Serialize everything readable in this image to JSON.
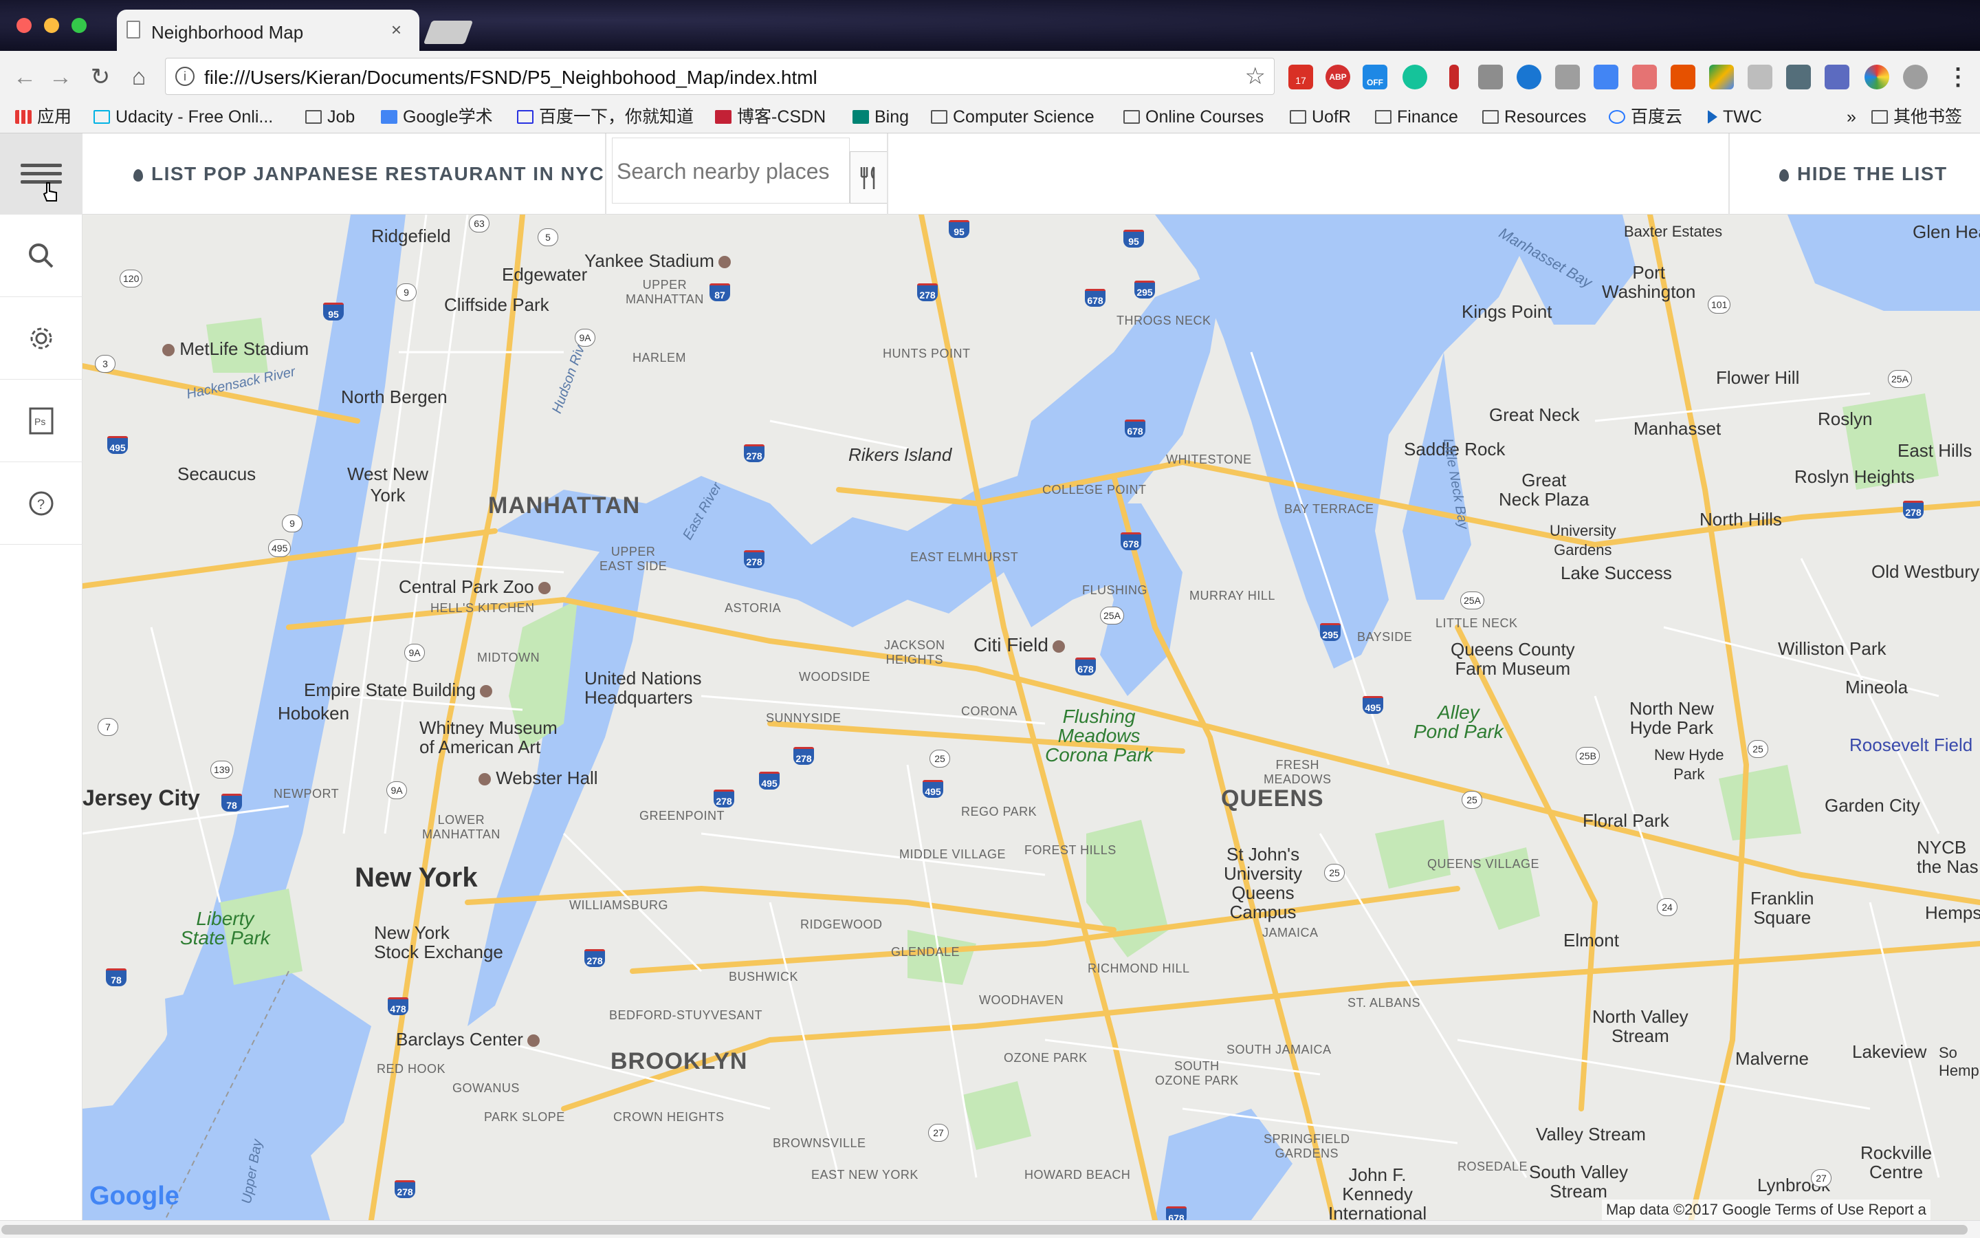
{
  "browser": {
    "tab_title": "Neighborhood Map",
    "tab_close": "×",
    "url": "file:///Users/Kieran/Documents/FSND/P5_Neighbohood_Map/index.html",
    "bookmarks": [
      "应用",
      "Udacity - Free Onli...",
      "Job",
      "Google学术",
      "百度一下，你就知道",
      "博客-CSDN",
      "Bing",
      "Computer Science",
      "Online Courses",
      "UofR",
      "Finance",
      "Resources",
      "百度云",
      "TWC"
    ],
    "bookmarks_overflow": "»",
    "other_bookmarks": "其他书签",
    "ext_badges": {
      "calendar": "17",
      "adblock": "ABP",
      "off": "OFF"
    }
  },
  "header": {
    "list_button": "LIST POP JANPANESE RESTAURANT IN NYC",
    "search_placeholder": "Search nearby places",
    "hide_button": "HIDE THE LIST"
  },
  "sidebar": {
    "items": [
      "search-icon",
      "gear-icon",
      "ps-icon",
      "help-icon"
    ]
  },
  "map": {
    "labels": {
      "manhattan": "MANHATTAN",
      "queens": "QUEENS",
      "brooklyn": "BROOKLYN",
      "new_york": "New York",
      "jersey_city": "Jersey City",
      "hoboken": "Hoboken",
      "secaucus": "Secaucus",
      "north_bergen": "North Bergen",
      "west_new_york": "West New\nYork",
      "ridgefield": "Ridgefield",
      "edgewater": "Edgewater",
      "cliffside_park": "Cliffside Park",
      "metlife": "MetLife Stadium",
      "yankee": "Yankee Stadium",
      "central_park_zoo": "Central Park Zoo",
      "empire": "Empire State Building",
      "whitney": "Whitney Museum\nof American Art",
      "un": "United Nations\nHeadquarters",
      "webster": "Webster Hall",
      "nyse": "New York\nStock Exchange",
      "liberty": "Liberty\nState Park",
      "barclays": "Barclays Center",
      "rikers": "Rikers Island",
      "citi_field": "Citi Field",
      "flushing_meadows": "Flushing\nMeadows\nCorona Park",
      "st_johns": "St John's\nUniversity\nQueens\nCampus",
      "queens_county_farm": "Queens County\nFarm Museum",
      "alley_pond": "Alley\nPond Park",
      "port_washington": "Port\nWashington",
      "baxter": "Baxter Estates",
      "kings_point": "Kings Point",
      "flower_hill": "Flower Hill",
      "great_neck": "Great Neck",
      "manhasset": "Manhasset",
      "roslyn": "Roslyn",
      "saddle_rock": "Saddle Rock",
      "great_neck_plaza": "Great\nNeck Plaza",
      "university_gardens": "University\nGardens",
      "lake_success": "Lake Success",
      "roslyn_heights": "Roslyn Heights",
      "north_hills": "North Hills",
      "east_hills": "East Hills",
      "old_westbury": "Old Westbury",
      "williston_park": "Williston Park",
      "mineola": "Mineola",
      "north_new_hyde_park": "North New\nHyde Park",
      "new_hyde_park": "New Hyde\nPark",
      "roosevelt_field": "Roosevelt Field",
      "garden_city": "Garden City",
      "floral_park": "Floral Park",
      "franklin_square": "Franklin\nSquare",
      "elmont": "Elmont",
      "north_valley_stream": "North Valley\nStream",
      "valley_stream": "Valley Stream",
      "south_valley_stream": "South Valley\nStream",
      "malverne": "Malverne",
      "lakeview": "Lakeview",
      "rockville_centre": "Rockville\nCentre",
      "lynbrook": "Lynbrook",
      "jfk": "John F.\nKennedy\nInternational",
      "glen_head": "Glen Hea",
      "nyc_the_nas": "NYCB\nthe Nas",
      "hemps": "Hemps",
      "s_hemp": "So\nHemp",
      "harlem": "HARLEM",
      "upper_manhattan": "UPPER\nMANHATTAN",
      "hunts_point": "HUNTS POINT",
      "throgs_neck": "THROGS NECK",
      "whitestone": "WHITESTONE",
      "college_point": "COLLEGE POINT",
      "bay_terrace": "BAY TERRACE",
      "flushing": "FLUSHING",
      "murray_hill": "MURRAY HILL",
      "bayside": "BAYSIDE",
      "little_neck": "LITTLE NECK",
      "east_elmhurst": "EAST ELMHURST",
      "astoria": "ASTORIA",
      "jackson_heights": "JACKSON\nHEIGHTS",
      "woodside": "WOODSIDE",
      "corona": "CORONA",
      "sunnyside": "SUNNYSIDE",
      "rego_park": "REGO PARK",
      "forest_hills": "FOREST HILLS",
      "fresh_meadows": "FRESH\nMEADOWS",
      "middle_village": "MIDDLE VILLAGE",
      "greenpoint": "GREENPOINT",
      "williamsburg": "WILLIAMSBURG",
      "ridgewood": "RIDGEWOOD",
      "glendale": "GLENDALE",
      "bushwick": "BUSHWICK",
      "bed_stuy": "BEDFORD-STUYVESANT",
      "richmond_hill": "RICHMOND HILL",
      "woodhaven": "WOODHAVEN",
      "ozone_park": "OZONE PARK",
      "south_ozone_park": "SOUTH\nOZONE PARK",
      "jamaica": "JAMAICA",
      "south_jamaica": "SOUTH JAMAICA",
      "st_albans": "ST. ALBANS",
      "queens_village": "QUEENS VILLAGE",
      "upper_east_side": "UPPER\nEAST SIDE",
      "hells_kitchen": "HELL'S KITCHEN",
      "midtown": "MIDTOWN",
      "lower_manhattan": "LOWER\nMANHATTAN",
      "newport": "NEWPORT",
      "red_hook": "RED HOOK",
      "gowanus": "GOWANUS",
      "park_slope": "PARK SLOPE",
      "crown_heights": "CROWN HEIGHTS",
      "brownsville": "BROWNSVILLE",
      "east_new_york": "EAST NEW YORK",
      "howard_beach": "HOWARD BEACH",
      "springfield_gardens": "SPRINGFIELD\nGARDENS",
      "rosedale": "ROSEDALE",
      "manhasset_bay": "Manhasset Bay",
      "hackensack_river": "Hackensack River",
      "hudson_river": "Hudson River",
      "east_river": "East River",
      "little_neck_bay": "Little Neck Bay",
      "upper_bay": "Upper Bay"
    },
    "shields": [
      "95",
      "95",
      "95",
      "278",
      "678",
      "295",
      "87",
      "278",
      "278",
      "678",
      "678",
      "295",
      "495",
      "495",
      "278",
      "495",
      "278",
      "278",
      "678",
      "278",
      "78",
      "78",
      "478",
      "278",
      "495",
      "678"
    ],
    "route_shields": [
      "63",
      "5",
      "120",
      "9",
      "9A",
      "3",
      "9",
      "495",
      "9A",
      "9A",
      "7",
      "139",
      "9A",
      "101",
      "25A",
      "25A",
      "25A",
      "25B",
      "25",
      "25",
      "25",
      "25",
      "24",
      "27",
      "27"
    ]
  },
  "footer": {
    "google": "Google",
    "attribution": "Map data ©2017 Google   Terms of Use   Report a"
  }
}
